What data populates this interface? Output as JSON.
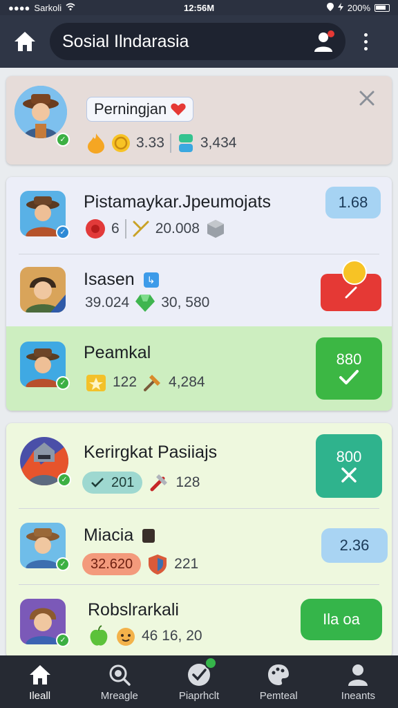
{
  "status_bar": {
    "carrier": "Sarkoli",
    "time": "12:56M",
    "battery": "200%"
  },
  "header": {
    "title": "Sosial Ilndarasia"
  },
  "featured": {
    "name": "Perningjan",
    "stat_1": "3.33",
    "stat_2": "3,434"
  },
  "group1": {
    "rows": [
      {
        "name": "Pistamaykar.Jpeumojats",
        "stat_a": "6",
        "stat_b": "20.008",
        "action": "1.68"
      },
      {
        "name": "Isasen",
        "stat_a": "39.024",
        "stat_b": "30, 580",
        "action": ""
      },
      {
        "name": "Peamkal",
        "stat_a": "122",
        "stat_b": "4,284",
        "action": "880"
      }
    ]
  },
  "group2": {
    "rows": [
      {
        "name": "Kerirgkat Pasiiajs",
        "stat_a": "201",
        "stat_b": "128",
        "action": "800"
      },
      {
        "name": "Miacia",
        "stat_a": "32.620",
        "stat_b": "221",
        "action": "2.36"
      },
      {
        "name": "Robslrarkali",
        "stat_a": "46 16, 20",
        "stat_b": "",
        "action": "Ila oa"
      }
    ]
  },
  "nav": {
    "items": [
      {
        "label": "Ileall"
      },
      {
        "label": "Mreagle"
      },
      {
        "label": "Piaprhclt"
      },
      {
        "label": "Pemteal"
      },
      {
        "label": "Ineants"
      }
    ]
  },
  "colors": {
    "accent_green": "#35b54a",
    "accent_teal": "#2fb38d",
    "accent_red": "#e53935",
    "accent_blue_pill": "#a9d4f3",
    "header_bg": "#2f3646"
  }
}
